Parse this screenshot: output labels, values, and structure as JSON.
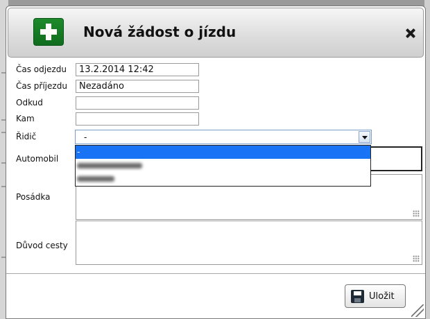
{
  "dialog": {
    "title": "Nová žádost o jízdu",
    "accent_color": "#1e8a2c"
  },
  "fields": {
    "departure": {
      "label": "Čas odjezdu",
      "value": "13.2.2014 12:42"
    },
    "arrival": {
      "label": "Čas příjezdu",
      "value": "Nezadáno"
    },
    "from": {
      "label": "Odkud",
      "value": ""
    },
    "to": {
      "label": "Kam",
      "value": ""
    },
    "driver": {
      "label": "Řidič",
      "value": "-",
      "options": [
        "-"
      ]
    },
    "car": {
      "label": "Automobil"
    },
    "crew": {
      "label": "Posádka"
    },
    "reason": {
      "label": "Důvod cesty"
    }
  },
  "actions": {
    "save_label": "Uložit"
  },
  "icons": {
    "logo": "plus-icon",
    "close": "close-icon",
    "save": "floppy-disk-icon"
  }
}
